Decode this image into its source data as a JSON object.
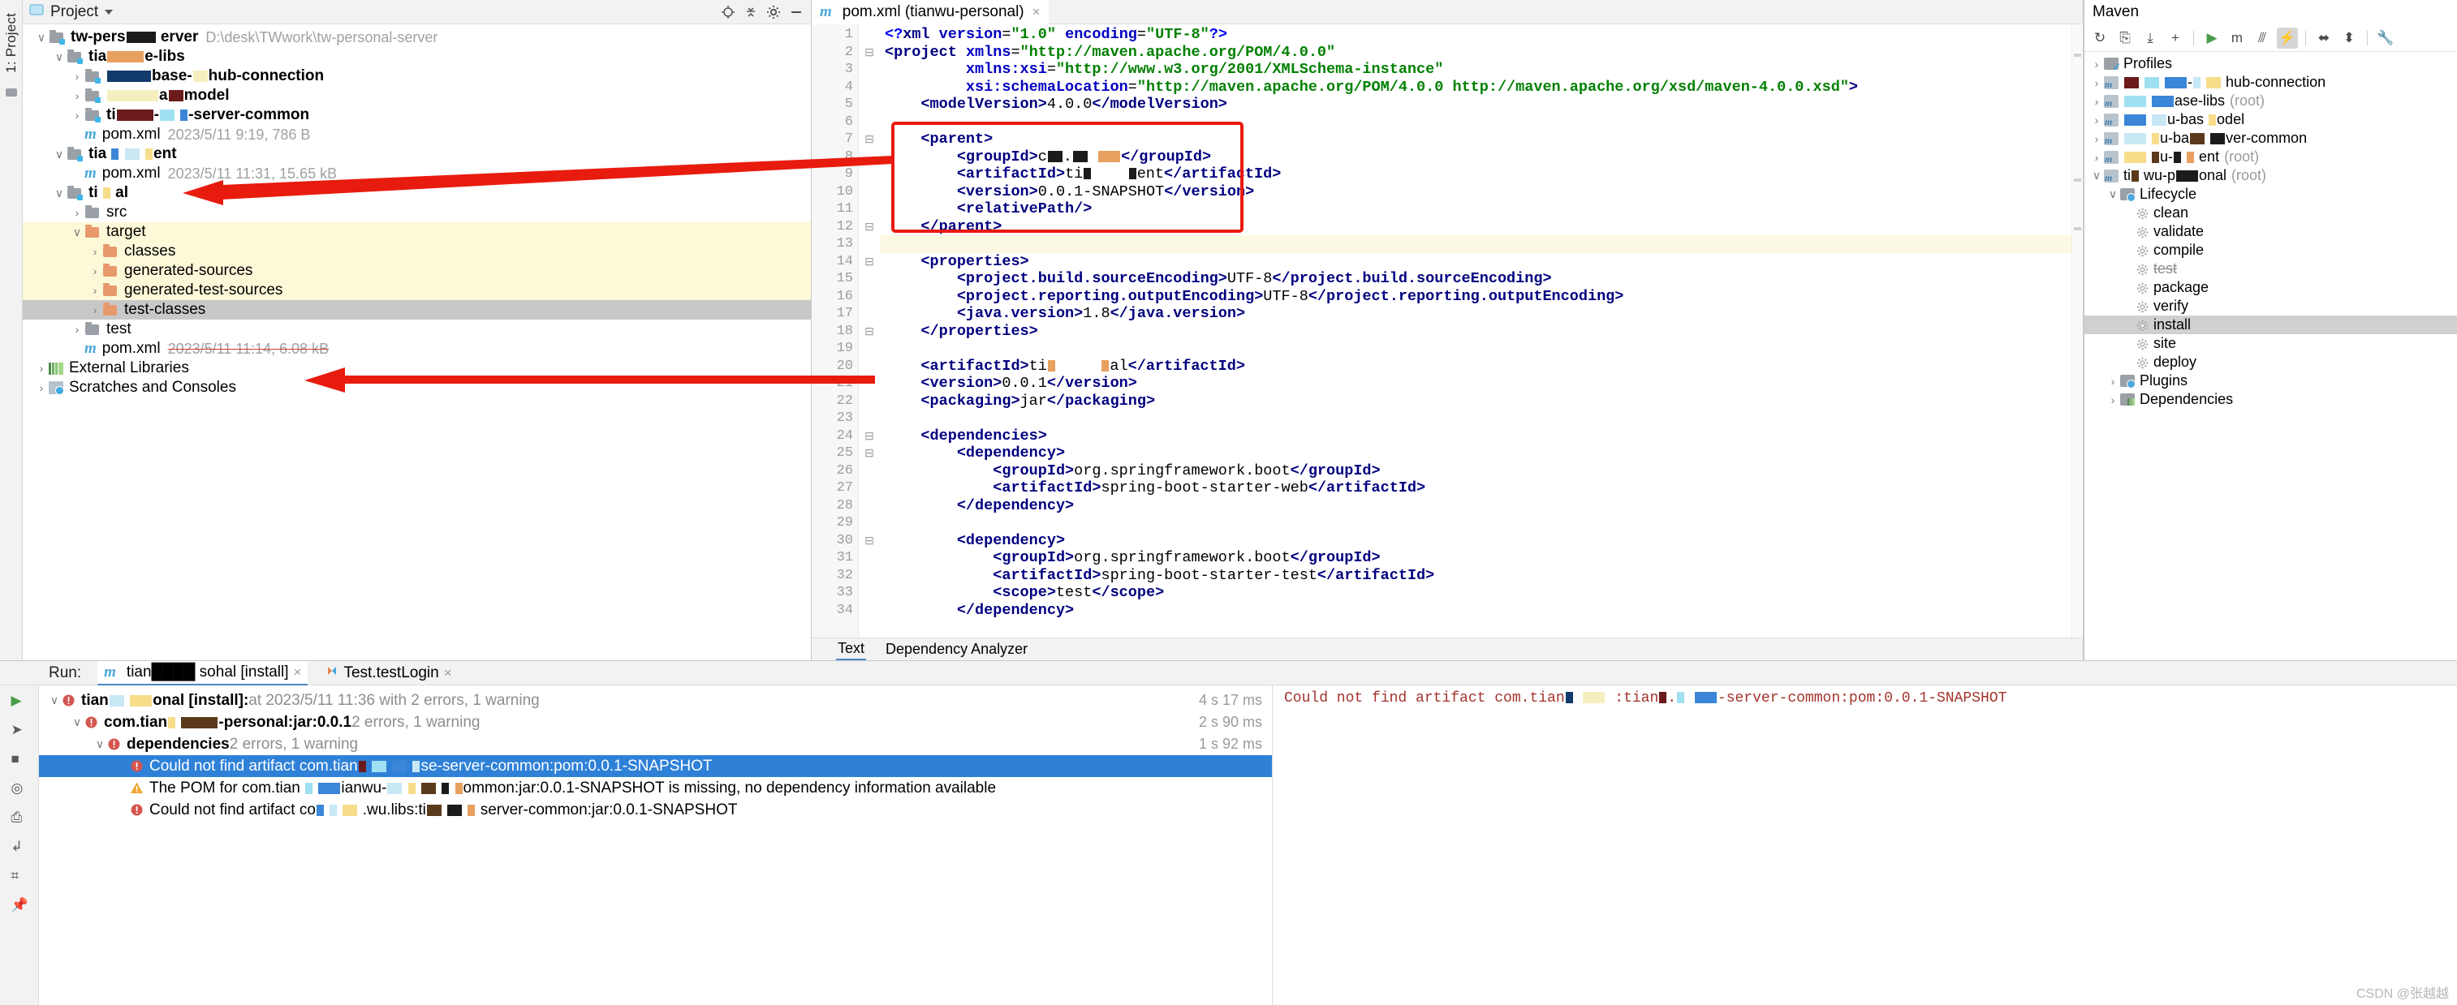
{
  "left_strip": {
    "label": "1: Project"
  },
  "project_panel": {
    "title": "Project",
    "tree": [
      {
        "indent": 0,
        "arrow": "v",
        "icon": "module-folder",
        "name": "tw-pers████  erver",
        "meta": "D:\\desk\\TWwork\\tw-personal-server",
        "bold": true
      },
      {
        "indent": 1,
        "arrow": "v",
        "icon": "module-folder",
        "name": "tia█████e-libs",
        "meta": "",
        "bold": true
      },
      {
        "indent": 2,
        "arrow": ">",
        "icon": "module-folder",
        "name": "██████base-██hub-connection",
        "meta": "",
        "bold": true
      },
      {
        "indent": 2,
        "arrow": ">",
        "icon": "module-folder",
        "name": "███████a██model",
        "meta": "",
        "bold": true
      },
      {
        "indent": 2,
        "arrow": ">",
        "icon": "module-folder",
        "name": "ti█████-██ █-server-common",
        "meta": "",
        "bold": true
      },
      {
        "indent": 2,
        "arrow": "",
        "icon": "maven-m",
        "name": "pom.xml",
        "meta": "2023/5/11 9:19, 786 B",
        "bold": false
      },
      {
        "indent": 1,
        "arrow": "v",
        "icon": "module-folder",
        "name": "tia █ ██  █ent",
        "meta": "",
        "bold": true
      },
      {
        "indent": 2,
        "arrow": "",
        "icon": "maven-m",
        "name": "pom.xml",
        "meta": "2023/5/11 11:31, 15.65 kB",
        "bold": false
      },
      {
        "indent": 1,
        "arrow": "v",
        "icon": "module-folder",
        "name": "ti        █  al",
        "meta": "",
        "bold": true
      },
      {
        "indent": 2,
        "arrow": ">",
        "icon": "folder-grey",
        "name": "src",
        "meta": "",
        "bold": false
      },
      {
        "indent": 2,
        "arrow": "v",
        "icon": "folder-orange",
        "name": "target",
        "meta": "",
        "bold": false,
        "hl": "yellow"
      },
      {
        "indent": 3,
        "arrow": ">",
        "icon": "folder-orange",
        "name": "classes",
        "meta": "",
        "bold": false,
        "hl": "yellow"
      },
      {
        "indent": 3,
        "arrow": ">",
        "icon": "folder-orange",
        "name": "generated-sources",
        "meta": "",
        "bold": false,
        "hl": "yellow"
      },
      {
        "indent": 3,
        "arrow": ">",
        "icon": "folder-orange",
        "name": "generated-test-sources",
        "meta": "",
        "bold": false,
        "hl": "yellow"
      },
      {
        "indent": 3,
        "arrow": ">",
        "icon": "folder-orange",
        "name": "test-classes",
        "meta": "",
        "bold": false,
        "hl": "grey"
      },
      {
        "indent": 2,
        "arrow": ">",
        "icon": "folder-grey",
        "name": "test",
        "meta": "",
        "bold": false
      },
      {
        "indent": 2,
        "arrow": "",
        "icon": "maven-m",
        "name": "pom.xml",
        "meta": "2023/5/11 11:14, 6.08 kB",
        "bold": false,
        "meta_strike": true
      },
      {
        "indent": 0,
        "arrow": ">",
        "icon": "libraries",
        "name": "External Libraries",
        "meta": "",
        "bold": false
      },
      {
        "indent": 0,
        "arrow": ">",
        "icon": "scratches",
        "name": "Scratches and Consoles",
        "meta": "",
        "bold": false
      }
    ]
  },
  "editor": {
    "tab": {
      "label": "pom.xml (tianwu-personal)",
      "close": "×"
    },
    "footer_tabs": [
      {
        "label": "Text",
        "active": true
      },
      {
        "label": "Dependency Analyzer",
        "active": false
      }
    ],
    "first_line": 1,
    "lines": [
      {
        "n": 1,
        "fold": "",
        "html": "<span class='pq'>&lt;?</span><span class='pi'>xml </span><span class='attr'>version</span><span class='txt'>=</span><span class='val'>\"1.0\"</span><span class='txt'> </span><span class='attr'>encoding</span><span class='txt'>=</span><span class='val'>\"UTF-8\"</span><span class='pq'>?&gt;</span>"
      },
      {
        "n": 2,
        "fold": "-",
        "html": "<span class='tag'>&lt;project</span> <span class='attr'>xmlns</span>=<span class='val'>\"http://maven.apache.org/POM/4.0.0\"</span>"
      },
      {
        "n": 3,
        "fold": "",
        "html": "         <span class='attr'>xmlns:xsi</span>=<span class='val'>\"http://www.w3.org/2001/XMLSchema-instance\"</span>"
      },
      {
        "n": 4,
        "fold": "",
        "html": "         <span class='attr'>xsi:schemaLocation</span>=<span class='val'>\"http://maven.apache.org/POM/4.0.0 http://maven.apache.org/xsd/maven-4.0.0.xsd\"</span><span class='tag'>&gt;</span>"
      },
      {
        "n": 5,
        "fold": "",
        "html": "    <span class='tag'>&lt;modelVersion&gt;</span><span class='txt'>4.0.0</span><span class='tag'>&lt;/modelVersion&gt;</span>"
      },
      {
        "n": 6,
        "fold": "",
        "html": ""
      },
      {
        "n": 7,
        "fold": "-",
        "html": "    <span class='tag'>&lt;parent&gt;</span>"
      },
      {
        "n": 8,
        "fold": "",
        "html": "        <span class='tag'>&lt;groupId&gt;</span><span class='txt'>c██.██ ███</span><span class='tag'>&lt;/groupId&gt;</span>"
      },
      {
        "n": 9,
        "fold": "",
        "html": "        <span class='tag'>&lt;artifactId&gt;</span><span class='txt'>ti█    █ent</span><span class='tag'>&lt;/artifactId&gt;</span>"
      },
      {
        "n": 10,
        "fold": "",
        "html": "        <span class='tag'>&lt;version&gt;</span><span class='txt'>0.0.1-SNAPSHOT</span><span class='tag'>&lt;/version&gt;</span>"
      },
      {
        "n": 11,
        "fold": "",
        "html": "        <span class='tag'>&lt;relativePath/&gt;</span>"
      },
      {
        "n": 12,
        "fold": "-",
        "html": "    <span class='tag'>&lt;/parent&gt;</span>"
      },
      {
        "n": 13,
        "fold": "",
        "html": "",
        "hl": true
      },
      {
        "n": 14,
        "fold": "-",
        "html": "    <span class='tag'>&lt;properties&gt;</span>"
      },
      {
        "n": 15,
        "fold": "",
        "html": "        <span class='tag'>&lt;project.build.sourceEncoding&gt;</span><span class='txt'>UTF-8</span><span class='tag'>&lt;/project.build.sourceEncoding&gt;</span>"
      },
      {
        "n": 16,
        "fold": "",
        "html": "        <span class='tag'>&lt;project.reporting.outputEncoding&gt;</span><span class='txt'>UTF-8</span><span class='tag'>&lt;/project.reporting.outputEncoding&gt;</span>"
      },
      {
        "n": 17,
        "fold": "",
        "html": "        <span class='tag'>&lt;java.version&gt;</span><span class='txt'>1.8</span><span class='tag'>&lt;/java.version&gt;</span>"
      },
      {
        "n": 18,
        "fold": "-",
        "html": "    <span class='tag'>&lt;/properties&gt;</span>"
      },
      {
        "n": 19,
        "fold": "",
        "html": ""
      },
      {
        "n": 20,
        "fold": "",
        "html": "    <span class='tag'>&lt;artifactId&gt;</span><span class='txt'>ti█     █al</span><span class='tag'>&lt;/artifactId&gt;</span>"
      },
      {
        "n": 21,
        "fold": "",
        "html": "    <span class='tag'>&lt;version&gt;</span><span class='txt'>0.0.1</span><span class='tag'>&lt;/version&gt;</span>"
      },
      {
        "n": 22,
        "fold": "",
        "html": "    <span class='tag'>&lt;packaging&gt;</span><span class='txt'>jar</span><span class='tag'>&lt;/packaging&gt;</span>"
      },
      {
        "n": 23,
        "fold": "",
        "html": ""
      },
      {
        "n": 24,
        "fold": "-",
        "html": "    <span class='tag'>&lt;dependencies&gt;</span>"
      },
      {
        "n": 25,
        "fold": "-",
        "html": "        <span class='tag'>&lt;dependency&gt;</span>"
      },
      {
        "n": 26,
        "fold": "",
        "html": "            <span class='tag'>&lt;groupId&gt;</span><span class='txt'>org.springframework.boot</span><span class='tag'>&lt;/groupId&gt;</span>"
      },
      {
        "n": 27,
        "fold": "",
        "html": "            <span class='tag'>&lt;artifactId&gt;</span><span class='txt'>spring-boot-starter-web</span><span class='tag'>&lt;/artifactId&gt;</span>"
      },
      {
        "n": 28,
        "fold": "",
        "html": "        <span class='tag'>&lt;/dependency&gt;</span>"
      },
      {
        "n": 29,
        "fold": "",
        "html": ""
      },
      {
        "n": 30,
        "fold": "-",
        "html": "        <span class='tag'>&lt;dependency&gt;</span>"
      },
      {
        "n": 31,
        "fold": "",
        "html": "            <span class='tag'>&lt;groupId&gt;</span><span class='txt'>org.springframework.boot</span><span class='tag'>&lt;/groupId&gt;</span>"
      },
      {
        "n": 32,
        "fold": "",
        "html": "            <span class='tag'>&lt;artifactId&gt;</span><span class='txt'>spring-boot-starter-test</span><span class='tag'>&lt;/artifactId&gt;</span>"
      },
      {
        "n": 33,
        "fold": "",
        "html": "            <span class='tag'>&lt;scope&gt;</span><span class='txt'>test</span><span class='tag'>&lt;/scope&gt;</span>"
      },
      {
        "n": 34,
        "fold": "",
        "html": "        <span class='tag'>&lt;/dependency&gt;</span>"
      }
    ]
  },
  "maven": {
    "title": "Maven",
    "toolbar": [
      {
        "name": "reload-all-maven-projects-icon",
        "glyph": "↻"
      },
      {
        "name": "generate-sources-icon",
        "glyph": "⎘"
      },
      {
        "name": "download-sources-icon",
        "glyph": "⤓"
      },
      {
        "name": "add-maven-project-icon",
        "glyph": "+"
      },
      {
        "name": "run-maven-build-icon",
        "glyph": "▶"
      },
      {
        "name": "execute-maven-goal-icon",
        "glyph": "m"
      },
      {
        "name": "toggle-offline-mode-icon",
        "glyph": "⫻"
      },
      {
        "name": "toggle-skip-tests-icon",
        "glyph": "⚡",
        "active": true
      },
      {
        "name": "expand-all-icon",
        "glyph": "⬌"
      },
      {
        "name": "collapse-all-icon",
        "glyph": "⬍"
      },
      {
        "name": "maven-settings-icon",
        "glyph": "🔧"
      }
    ],
    "tree": [
      {
        "indent": 0,
        "arrow": ">",
        "icon": "profiles",
        "name": "Profiles",
        "suffix": ""
      },
      {
        "indent": 0,
        "arrow": ">",
        "icon": "maven-module",
        "name": "██ ██ ███-█   ██ hub-connection",
        "suffix": ""
      },
      {
        "indent": 0,
        "arrow": ">",
        "icon": "maven-module",
        "name": "███  ███ase-libs",
        "suffix": "(root)"
      },
      {
        "indent": 0,
        "arrow": ">",
        "icon": "maven-module",
        "name": "███ ██u-bas █odel",
        "suffix": ""
      },
      {
        "indent": 0,
        "arrow": ">",
        "icon": "maven-module",
        "name": "███ █u-ba██ ██ver-common",
        "suffix": ""
      },
      {
        "indent": 0,
        "arrow": ">",
        "icon": "maven-module",
        "name": "███ █u-█ █ ent",
        "suffix": "(root)"
      },
      {
        "indent": 0,
        "arrow": "v",
        "icon": "maven-module",
        "name": "ti█ wu-p███onal",
        "suffix": "(root)"
      },
      {
        "indent": 1,
        "arrow": "v",
        "icon": "folder-cfg",
        "name": "Lifecycle",
        "suffix": ""
      },
      {
        "indent": 2,
        "arrow": "",
        "icon": "gear",
        "name": "clean",
        "suffix": ""
      },
      {
        "indent": 2,
        "arrow": "",
        "icon": "gear",
        "name": "validate",
        "suffix": ""
      },
      {
        "indent": 2,
        "arrow": "",
        "icon": "gear",
        "name": "compile",
        "suffix": ""
      },
      {
        "indent": 2,
        "arrow": "",
        "icon": "gear",
        "name": "test",
        "suffix": "",
        "strike": true
      },
      {
        "indent": 2,
        "arrow": "",
        "icon": "gear",
        "name": "package",
        "suffix": ""
      },
      {
        "indent": 2,
        "arrow": "",
        "icon": "gear",
        "name": "verify",
        "suffix": ""
      },
      {
        "indent": 2,
        "arrow": "",
        "icon": "gear",
        "name": "install",
        "suffix": "",
        "selected": true
      },
      {
        "indent": 2,
        "arrow": "",
        "icon": "gear",
        "name": "site",
        "suffix": ""
      },
      {
        "indent": 2,
        "arrow": "",
        "icon": "gear",
        "name": "deploy",
        "suffix": ""
      },
      {
        "indent": 1,
        "arrow": ">",
        "icon": "folder-cfg",
        "name": "Plugins",
        "suffix": ""
      },
      {
        "indent": 1,
        "arrow": ">",
        "icon": "dependencies",
        "name": "Dependencies",
        "suffix": ""
      }
    ]
  },
  "run_panel": {
    "run_label": "Run:",
    "tabs": [
      {
        "label": "tian████ sohal [install]",
        "icon": "maven-m",
        "active": true,
        "close": "×"
      },
      {
        "label": "Test.testLogin",
        "icon": "run-test",
        "active": false,
        "close": "×"
      }
    ],
    "gutter_icons": [
      {
        "name": "rerun-icon",
        "glyph": "▶"
      },
      {
        "name": "rerun-failed-icon",
        "glyph": "➤"
      },
      {
        "name": "stop-icon",
        "glyph": "■"
      },
      {
        "name": "filter-icon",
        "glyph": "◎"
      },
      {
        "name": "soft-wrap-icon",
        "glyph": "⎙"
      },
      {
        "name": "scroll-to-end-icon",
        "glyph": "↲"
      },
      {
        "name": "print-icon",
        "glyph": "⌗"
      },
      {
        "name": "pin-icon",
        "glyph": "📌"
      }
    ],
    "rows": [
      {
        "indent": 0,
        "arrow": "v",
        "status": "error",
        "bold": "tian██ ███onal [install]:",
        "text": " at 2023/5/11 11:36 with 2 errors, 1 warning",
        "duration": "4 s 17 ms"
      },
      {
        "indent": 1,
        "arrow": "v",
        "status": "error",
        "bold": "com.tian█ █████-personal:jar:0.0.1",
        "text": "  2 errors, 1 warning",
        "duration": "2 s 90 ms"
      },
      {
        "indent": 2,
        "arrow": "v",
        "status": "error",
        "bold": "dependencies",
        "text": "  2 errors, 1 warning",
        "duration": "1 s 92 ms"
      },
      {
        "indent": 3,
        "arrow": "",
        "status": "error",
        "bold": "",
        "text": "Could not find artifact com.tian█  ██ ██      █se-server-common:pom:0.0.1-SNAPSHOT",
        "duration": "",
        "selected": true
      },
      {
        "indent": 3,
        "arrow": "",
        "status": "warning",
        "bold": "",
        "text": "The POM for com.tian █ ███ianwu-██ █ ██ █ █ommon:jar:0.0.1-SNAPSHOT is missing, no dependency information available",
        "duration": ""
      },
      {
        "indent": 3,
        "arrow": "",
        "status": "error",
        "bold": "",
        "text": "Could not find artifact co█ █ ██ .wu.libs:ti██   ██ █ server-common:jar:0.0.1-SNAPSHOT",
        "duration": ""
      }
    ],
    "console_text": "Could not find artifact com.tian█ ███ :tian█.█ ███-server-common:pom:0.0.1-SNAPSHOT"
  },
  "watermark": "CSDN @张越越",
  "colors": {
    "selection_blue": "#2f81d8",
    "highlight_yellow": "#fdf8d8",
    "selection_grey": "#c8c8c8",
    "arrow_red": "#e81b0f",
    "error_red": "#d4564f",
    "warning_orange": "#f0a732"
  }
}
